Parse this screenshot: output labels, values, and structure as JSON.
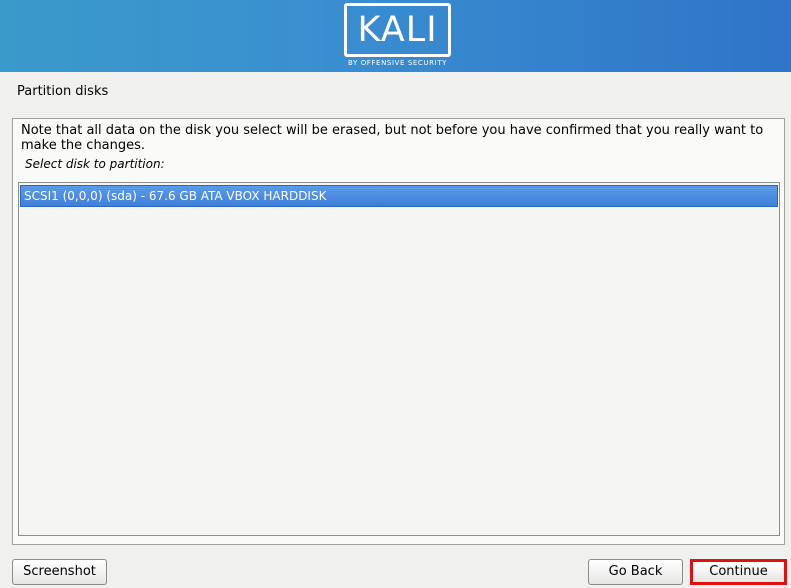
{
  "banner": {
    "logo_text": "KALI",
    "logo_subtitle": "BY OFFENSIVE SECURITY"
  },
  "page": {
    "title": "Partition disks",
    "note": "Note that all data on the disk you select will be erased, but not before you have confirmed that you really want to make the changes.",
    "prompt": "Select disk to partition:"
  },
  "disks": [
    {
      "label": "SCSI1 (0,0,0) (sda) - 67.6 GB ATA VBOX HARDDISK",
      "selected": true
    }
  ],
  "buttons": {
    "screenshot": "Screenshot",
    "go_back": "Go Back",
    "continue": "Continue"
  },
  "colors": {
    "banner": "#3a8fd0",
    "selection": "#4a8be0",
    "highlight_border": "#e01010"
  }
}
